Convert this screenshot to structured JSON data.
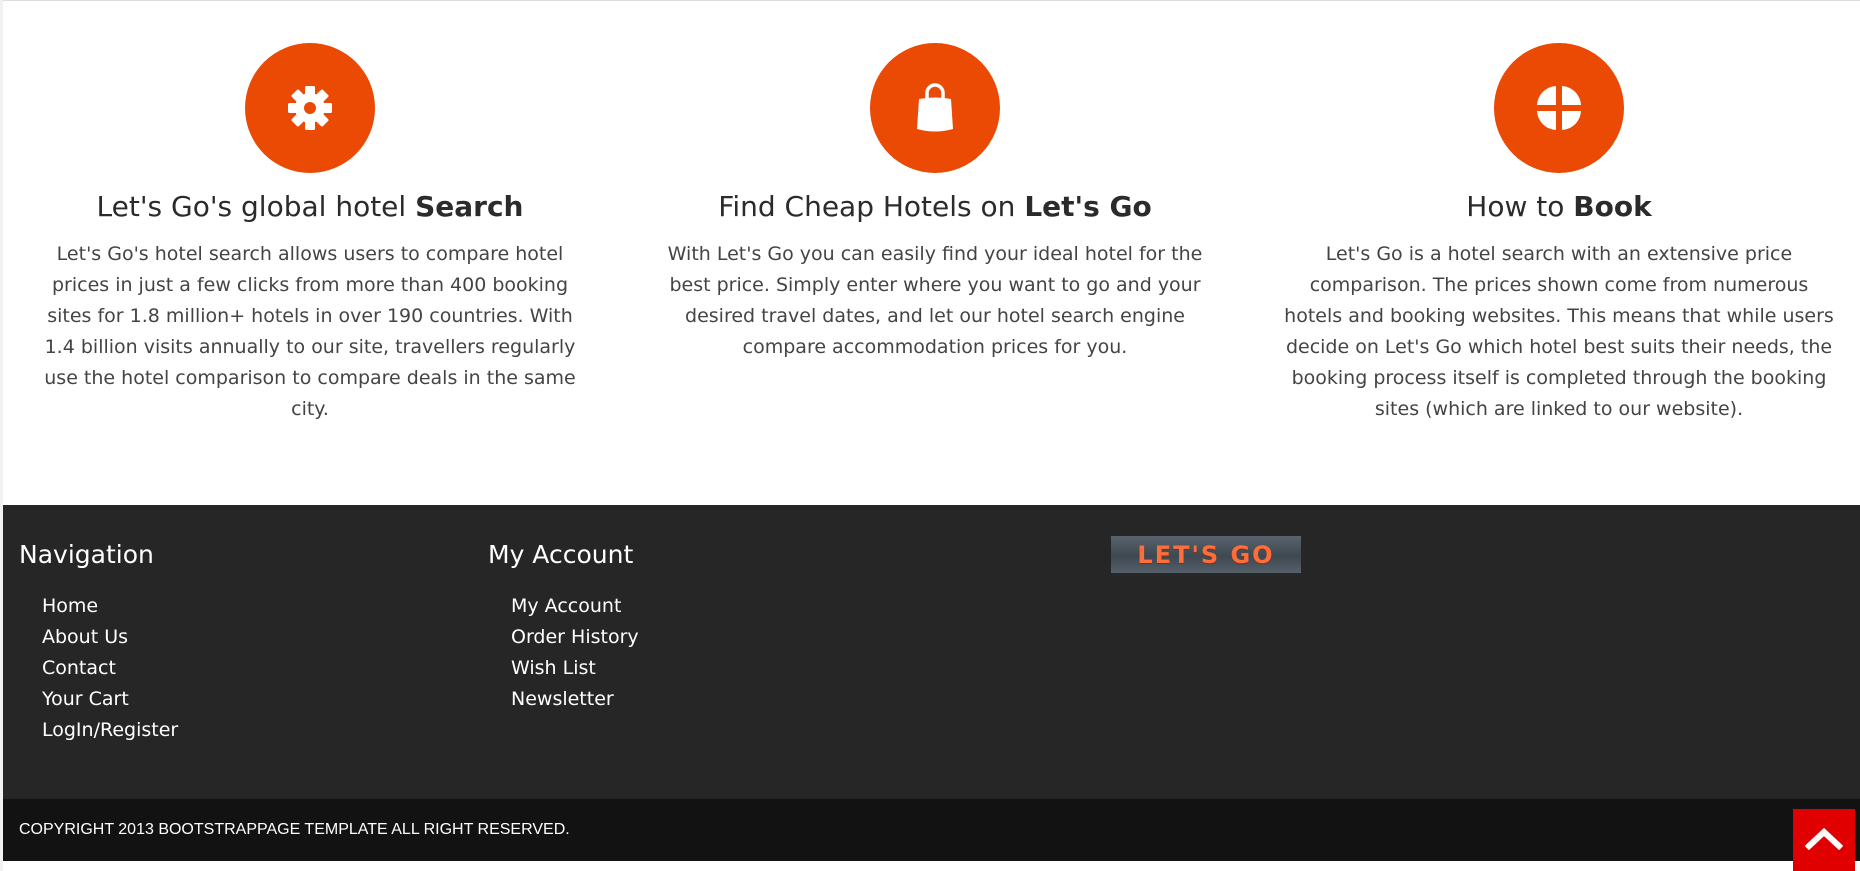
{
  "colors": {
    "accent": "#ea4a04",
    "footer_bg": "#262626",
    "bottom_bar_bg": "#121212",
    "back_to_top_bg": "#e00000"
  },
  "features": [
    {
      "icon": "gear-icon",
      "title_prefix": "Let's Go's global hotel ",
      "title_bold": "Search",
      "text": "Let's Go's hotel search allows users to compare hotel prices in just a few clicks from more than 400 booking sites for 1.8 million+ hotels in over 190 countries. With 1.4 billion visits annually to our site, travellers regularly use the hotel comparison to compare deals in the same city."
    },
    {
      "icon": "shopping-bag-icon",
      "title_prefix": "Find Cheap Hotels on ",
      "title_bold": "Let's Go",
      "text": "With Let's Go you can easily find your ideal hotel for the best price. Simply enter where you want to go and your desired travel dates, and let our hotel search engine compare accommodation prices for you."
    },
    {
      "icon": "grid-circle-icon",
      "title_prefix": "How to ",
      "title_bold": "Book",
      "text": "Let's Go is a hotel search with an extensive price comparison. The prices shown come from numerous hotels and booking websites. This means that while users decide on Let's Go which hotel best suits their needs, the booking process itself is completed through the booking sites (which are linked to our website)."
    }
  ],
  "footer": {
    "navigation": {
      "heading": "Navigation",
      "items": [
        "Home",
        "About Us",
        "Contact",
        "Your Cart",
        "LogIn/Register"
      ]
    },
    "account": {
      "heading": "My Account",
      "items": [
        "My Account",
        "Order History",
        "Wish List",
        "Newsletter"
      ]
    },
    "logo_text": "LET'S GO"
  },
  "copyright": "COPYRIGHT 2013 BOOTSTRAPPAGE TEMPLATE ALL RIGHT RESERVED.",
  "back_to_top_icon": "chevron-up-icon"
}
